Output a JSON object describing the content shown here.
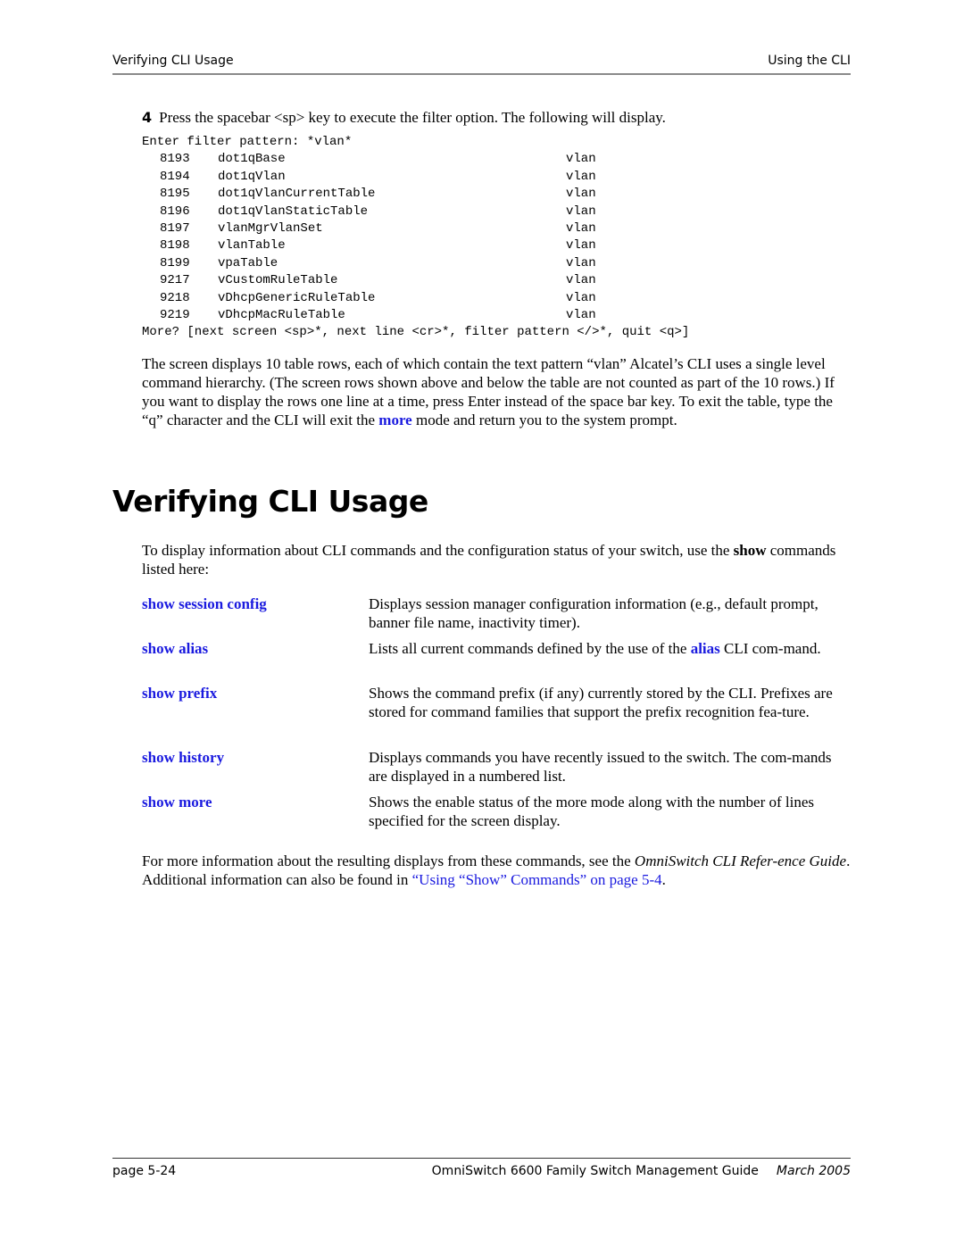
{
  "header": {
    "left": "Verifying CLI Usage",
    "right": "Using the CLI"
  },
  "step": {
    "number": "4",
    "text": "Press the spacebar <sp> key to execute the filter option. The following will display."
  },
  "code": {
    "prompt": "Enter filter pattern: *vlan*",
    "rows": [
      {
        "id": "8193",
        "name": "dot1qBase",
        "group": "vlan"
      },
      {
        "id": "8194",
        "name": "dot1qVlan",
        "group": "vlan"
      },
      {
        "id": "8195",
        "name": "dot1qVlanCurrentTable",
        "group": "vlan"
      },
      {
        "id": "8196",
        "name": "dot1qVlanStaticTable",
        "group": "vlan"
      },
      {
        "id": "8197",
        "name": "vlanMgrVlanSet",
        "group": "vlan"
      },
      {
        "id": "8198",
        "name": "vlanTable",
        "group": "vlan"
      },
      {
        "id": "8199",
        "name": "vpaTable",
        "group": "vlan"
      },
      {
        "id": "9217",
        "name": "vCustomRuleTable",
        "group": "vlan"
      },
      {
        "id": "9218",
        "name": "vDhcpGenericRuleTable",
        "group": "vlan"
      },
      {
        "id": "9219",
        "name": "vDhcpMacRuleTable",
        "group": "vlan"
      }
    ],
    "more_prompt": "More? [next screen <sp>*, next line <cr>*, filter pattern </>*, quit <q>]"
  },
  "explanation": {
    "before_link": "The screen displays 10 table rows, each of which contain the text pattern “vlan” Alcatel’s CLI uses a single level command hierarchy. (The screen rows shown above and below the table are not counted as part of the 10 rows.) If you want to display the rows one line at a time, press Enter instead of the space bar key. To exit the table, type the “q” character and the CLI will exit the ",
    "link": "more",
    "after_link": " mode and return you to the system prompt."
  },
  "section": {
    "title": "Verifying CLI Usage",
    "intro_before": "To display information about CLI commands and the configuration status of your switch, use the ",
    "intro_bold": "show",
    "intro_after": " commands listed here:"
  },
  "commands": [
    {
      "term": "show session config",
      "desc": "Displays session manager configuration information (e.g., default prompt, banner file name, inactivity timer)."
    },
    {
      "term": "show alias",
      "desc_before": "Lists all current commands defined by the use of the ",
      "desc_link": "alias",
      "desc_after": " CLI com-mand."
    },
    {
      "term": "show prefix",
      "desc": "Shows the command prefix (if any) currently stored by the CLI. Prefixes are stored for command families that support the prefix recognition fea-ture."
    },
    {
      "term": "show history",
      "desc": "Displays commands you have recently issued to the switch. The com-mands are displayed in a numbered list."
    },
    {
      "term": "show more",
      "desc": "Shows the enable status of the more mode along with the number of lines specified for the screen display."
    }
  ],
  "closing": {
    "text1": "For more information about the resulting displays from these commands, see the ",
    "italic": "OmniSwitch CLI Refer-ence Guide",
    "text2": ". Additional information can also be found in ",
    "link": "“Using “Show” Commands” on page 5-4",
    "text3": "."
  },
  "footer": {
    "page": "page 5-24",
    "guide": "OmniSwitch 6600 Family Switch Management Guide",
    "date": "March 2005"
  },
  "colors": {
    "link": "#1a1adf",
    "rule": "#8a8a8a"
  }
}
